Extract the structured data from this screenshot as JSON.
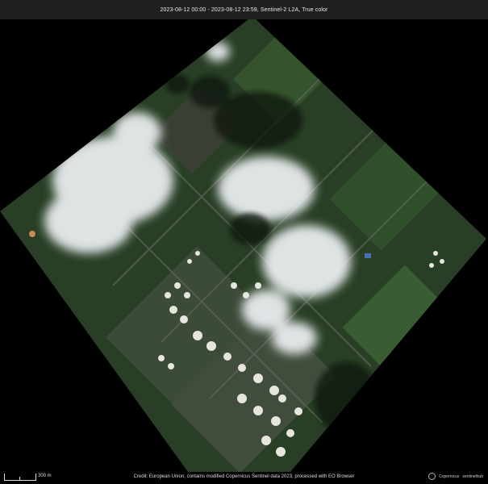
{
  "header": {
    "title": "2023-08-12 00:00 - 2023-08-12 23:59, Sentinel-2 L2A, True color"
  },
  "scale": {
    "label": "300 m"
  },
  "credit": "Credit: European Union, contains modified Copernicus Sentinel data 2023, processed with EO Browser",
  "logos": {
    "copernicus": "Copernicus",
    "sentinelhub": "sentinelhub"
  },
  "colors": {
    "background": "#000000",
    "vegetation": "#2d4a2a",
    "cloud": "#f2f4f6",
    "header": "#1f1f1f"
  }
}
